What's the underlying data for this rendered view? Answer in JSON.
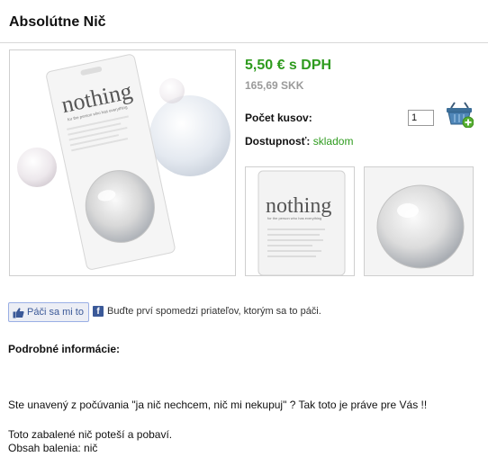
{
  "product": {
    "title": "Absolútne Nič",
    "price": "5,50 € s DPH",
    "old_price": "165,69 SKK",
    "qty_label": "Počet kusov:",
    "qty_value": "1",
    "availability_label": "Dostupnosť:",
    "availability_value": "skladom",
    "package_text": "nothing",
    "package_tagline": "for the person who has everything"
  },
  "social": {
    "like_label": "Páči sa mi to",
    "fb_text": "Buďte prví spomedzi priateľov, ktorým sa to páči."
  },
  "details": {
    "heading": "Podrobné informácie:",
    "description_1": "Ste unavený z počúvania \"ja nič nechcem, nič mi nekupuj\" ? Tak toto je práve pre Vás !!",
    "description_2": "Toto zabalené nič poteší a pobaví.",
    "description_3": "Obsah balenia: nič"
  },
  "colors": {
    "price_green": "#2e9b1e",
    "old_price_gray": "#9a9a9a",
    "fb_blue": "#3b5998",
    "like_bg": "#eceef5"
  },
  "icons": {
    "cart": "shopping-basket-add-icon",
    "like": "thumbs-up-icon",
    "facebook": "facebook-icon"
  }
}
